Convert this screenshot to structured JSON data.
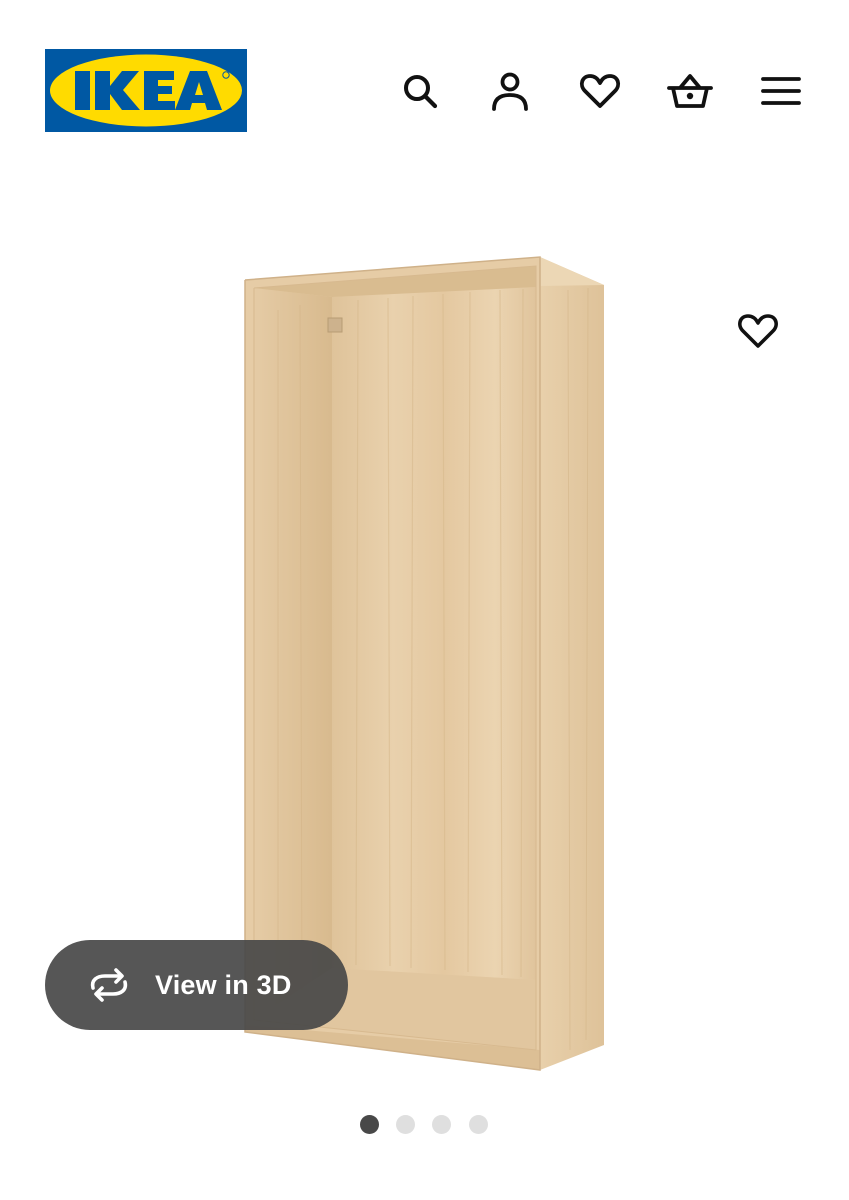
{
  "brand": {
    "logo_text": "IKEA",
    "logo_blue": "#0058a3",
    "logo_yellow": "#ffdb00"
  },
  "header": {
    "icons": [
      "search-icon",
      "account-icon",
      "heart-icon",
      "shopping-basket-icon",
      "hamburger-menu-icon"
    ]
  },
  "product": {
    "image": "open-wardrobe-frame-white-stained-oak",
    "favourite_icon": "heart-icon"
  },
  "view3d": {
    "label": "View in 3D",
    "icon": "rotate-arrows-icon"
  },
  "carousel": {
    "total": 4,
    "active": 1
  },
  "colors": {
    "icon": "#111111",
    "pill_bg": "#484848",
    "dot_active": "#484848",
    "dot_inactive": "#dfdfdf",
    "wood_light": "#e8cfa8",
    "wood_mid": "#dcbd92",
    "wood_dark": "#c9a677"
  }
}
